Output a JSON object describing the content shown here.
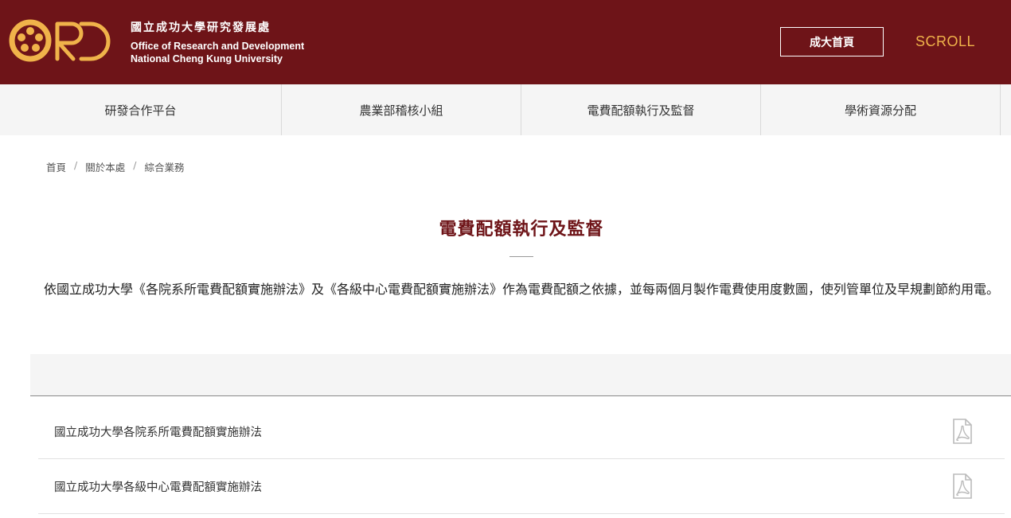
{
  "header": {
    "org_zh": "國立成功大學研究發展處",
    "org_en_line1": "Office of Research and Development",
    "org_en_line2": "National Cheng Kung University",
    "home_label": "成大首頁",
    "scroll_label": "SCROLL"
  },
  "nav": {
    "items": [
      {
        "label": "研發合作平台"
      },
      {
        "label": "農業部稽核小組"
      },
      {
        "label": "電費配額執行及監督"
      },
      {
        "label": "學術資源分配"
      }
    ]
  },
  "breadcrumb": {
    "items": [
      {
        "label": "首頁"
      },
      {
        "label": "關於本處"
      },
      {
        "label": "綜合業務"
      }
    ],
    "separator": "/"
  },
  "main": {
    "title": "電費配額執行及監督",
    "description": "依國立成功大學《各院系所電費配額實施辦法》及《各級中心電費配額實施辦法》作為電費配額之依據，並每兩個月製作電費使用度數圖，使列管單位及早規劃節約用電。",
    "documents": [
      {
        "name": "國立成功大學各院系所電費配額實施辦法",
        "icon": "pdf-icon"
      },
      {
        "name": "國立成功大學各級中心電費配額實施辦法",
        "icon": "pdf-icon"
      }
    ]
  },
  "colors": {
    "brand": "#6e1418",
    "accent": "#f0b34a"
  }
}
